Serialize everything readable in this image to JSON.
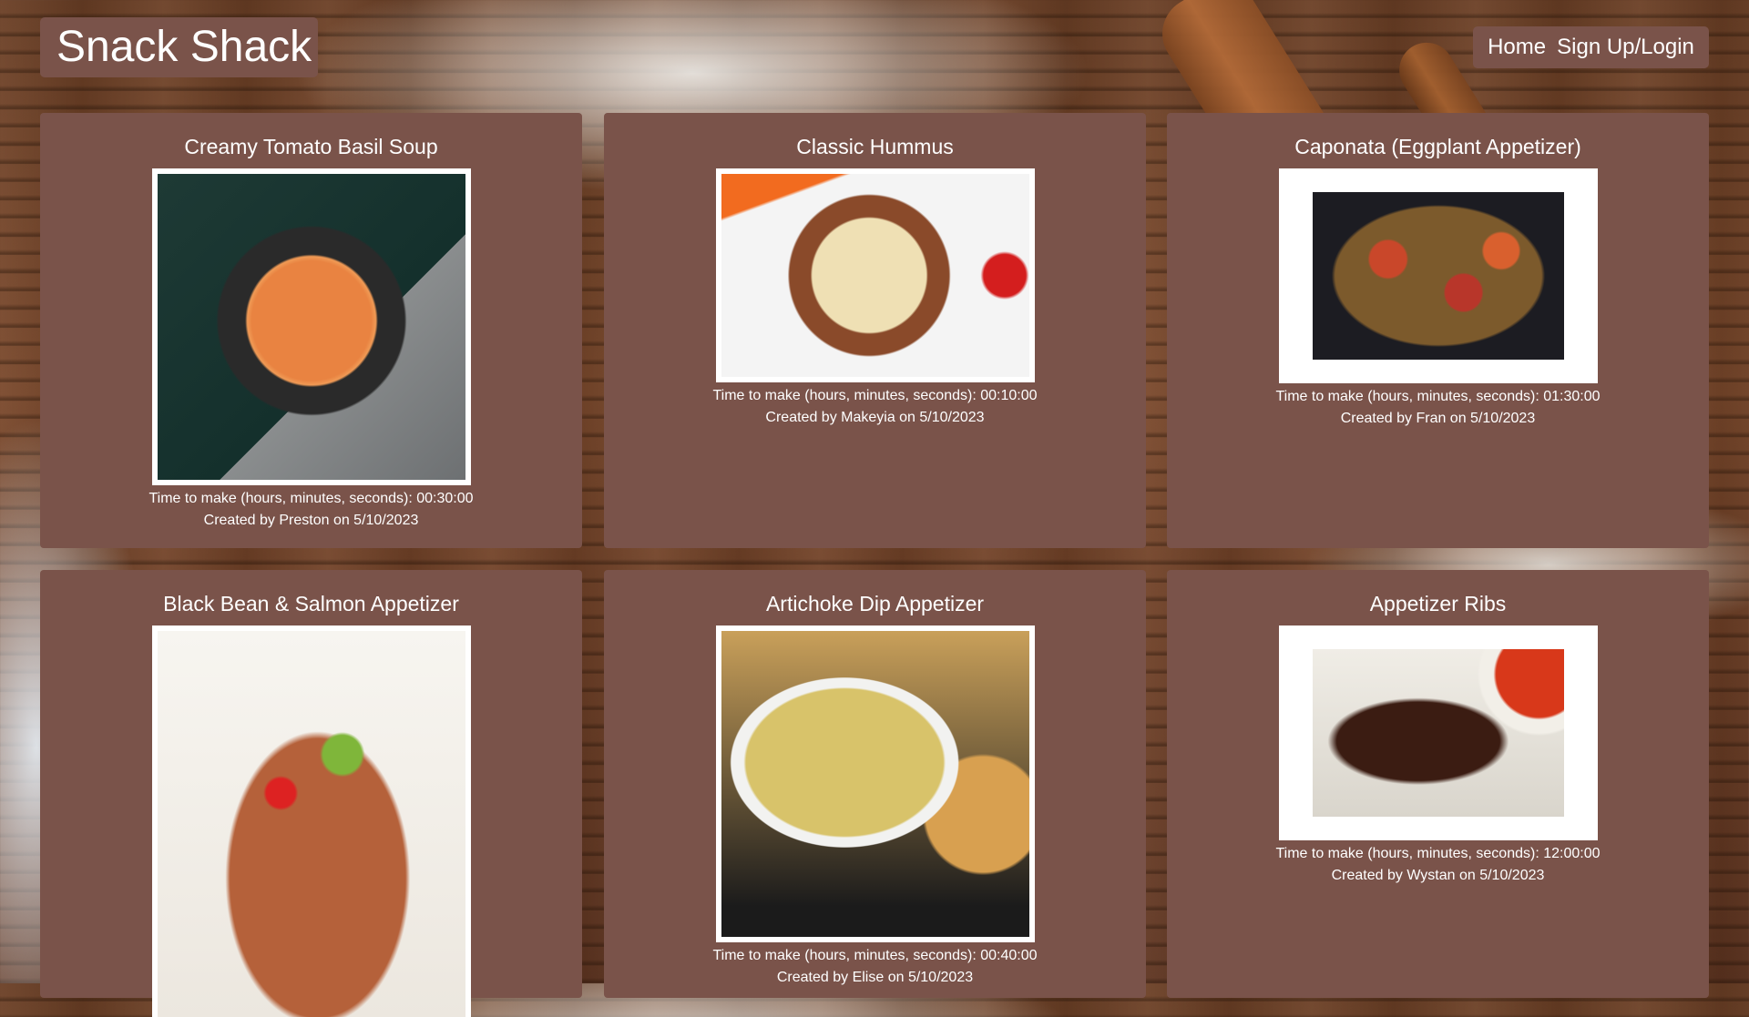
{
  "site": {
    "title": "Snack Shack"
  },
  "nav": {
    "home": "Home",
    "signup": "Sign Up/Login"
  },
  "recipes": [
    {
      "title": "Creamy Tomato Basil Soup",
      "time": "Time to make (hours, minutes, seconds): 00:30:00",
      "created": "Created by Preston on 5/10/2023",
      "image_alt": "Creamy Tomato Basil Soup"
    },
    {
      "title": "Classic Hummus",
      "time": "Time to make (hours, minutes, seconds): 00:10:00",
      "created": "Created by Makeyia on 5/10/2023",
      "image_alt": "Classic Hummus"
    },
    {
      "title": "Caponata (Eggplant Appetizer)",
      "time": "Time to make (hours, minutes, seconds): 01:30:00",
      "created": "Created by Fran on 5/10/2023",
      "image_alt": "Caponata (Eggplant Appetizer)"
    },
    {
      "title": "Black Bean & Salmon Appetizer",
      "time": "",
      "created": "",
      "image_alt": "Black Bean & Salmon Appetizer"
    },
    {
      "title": "Artichoke Dip Appetizer",
      "time": "Time to make (hours, minutes, seconds): 00:40:00",
      "created": "Created by Elise on 5/10/2023",
      "image_alt": "Artichoke Dip Appetizer"
    },
    {
      "title": "Appetizer Ribs",
      "time": "Time to make (hours, minutes, seconds): 12:00:00",
      "created": "Created by Wystan on 5/10/2023",
      "image_alt": "Appetizer Ribs"
    }
  ],
  "colors": {
    "card_bg": "#7a534a",
    "text": "#ffffff",
    "photo_frame": "#ffffff"
  }
}
